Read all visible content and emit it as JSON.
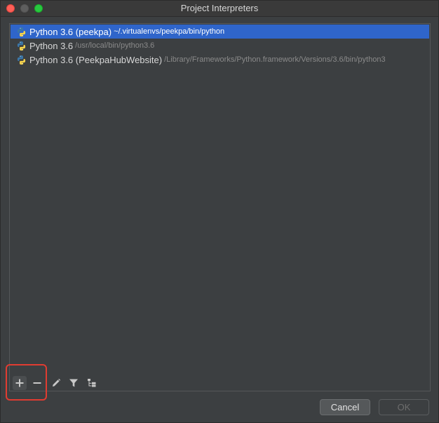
{
  "window": {
    "title": "Project Interpreters"
  },
  "interpreters": [
    {
      "name": "Python 3.6 (peekpa)",
      "path": "~/.virtualenvs/peekpa/bin/python",
      "selected": true
    },
    {
      "name": "Python 3.6",
      "path": "/usr/local/bin/python3.6",
      "selected": false
    },
    {
      "name": "Python 3.6 (PeekpaHubWebsite)",
      "path": "/Library/Frameworks/Python.framework/Versions/3.6/bin/python3",
      "selected": false
    }
  ],
  "toolbar": {
    "icons": [
      "plus-icon",
      "minus-icon",
      "pencil-icon",
      "filter-icon",
      "tree-icon"
    ]
  },
  "buttons": {
    "cancel": "Cancel",
    "ok": "OK"
  },
  "colors": {
    "selection": "#2f65ca",
    "highlight": "#e03c31",
    "background": "#3c3f41"
  }
}
